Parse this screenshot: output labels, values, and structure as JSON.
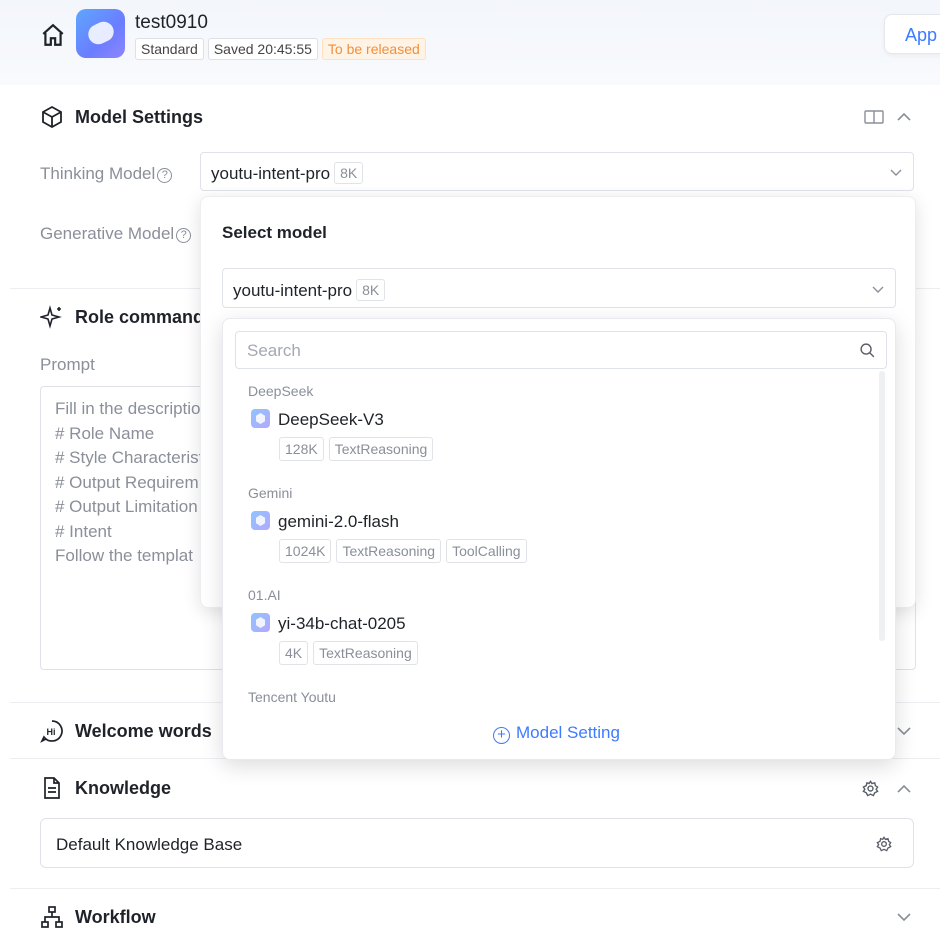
{
  "header": {
    "app_name": "test0910",
    "tag_standard": "Standard",
    "tag_saved": "Saved 20:45:55",
    "tag_status": "To be released",
    "app_button": "App"
  },
  "model_settings": {
    "title": "Model Settings",
    "thinking_label": "Thinking Model",
    "thinking_value": "youtu-intent-pro",
    "thinking_ctx": "8K",
    "generative_label": "Generative Model"
  },
  "role_commands": {
    "title": "Role commands",
    "prompt_label": "Prompt",
    "prompt_lines": [
      "Fill in the descriptio",
      "# Role Name",
      "# Style Characterist",
      "# Output Requirem",
      "# Output Limitation",
      "# Intent",
      "Follow the templat"
    ]
  },
  "select_model_popup": {
    "title": "Select model",
    "current_value": "youtu-intent-pro",
    "current_ctx": "8K",
    "search_placeholder": "Search",
    "groups": [
      {
        "name": "DeepSeek",
        "model": "DeepSeek-V3",
        "tags": [
          "128K",
          "TextReasoning"
        ]
      },
      {
        "name": "Gemini",
        "model": "gemini-2.0-flash",
        "tags": [
          "1024K",
          "TextReasoning",
          "ToolCalling"
        ]
      },
      {
        "name": "01.AI",
        "model": "yi-34b-chat-0205",
        "tags": [
          "4K",
          "TextReasoning"
        ]
      },
      {
        "name": "Tencent Youtu"
      }
    ],
    "model_setting_link": "Model Setting"
  },
  "welcome": {
    "title": "Welcome words"
  },
  "knowledge": {
    "title": "Knowledge",
    "default_kb": "Default Knowledge Base"
  },
  "workflow": {
    "title": "Workflow"
  },
  "colors": {
    "accent": "#3d7bff",
    "status_orange": "#f08f3c"
  }
}
